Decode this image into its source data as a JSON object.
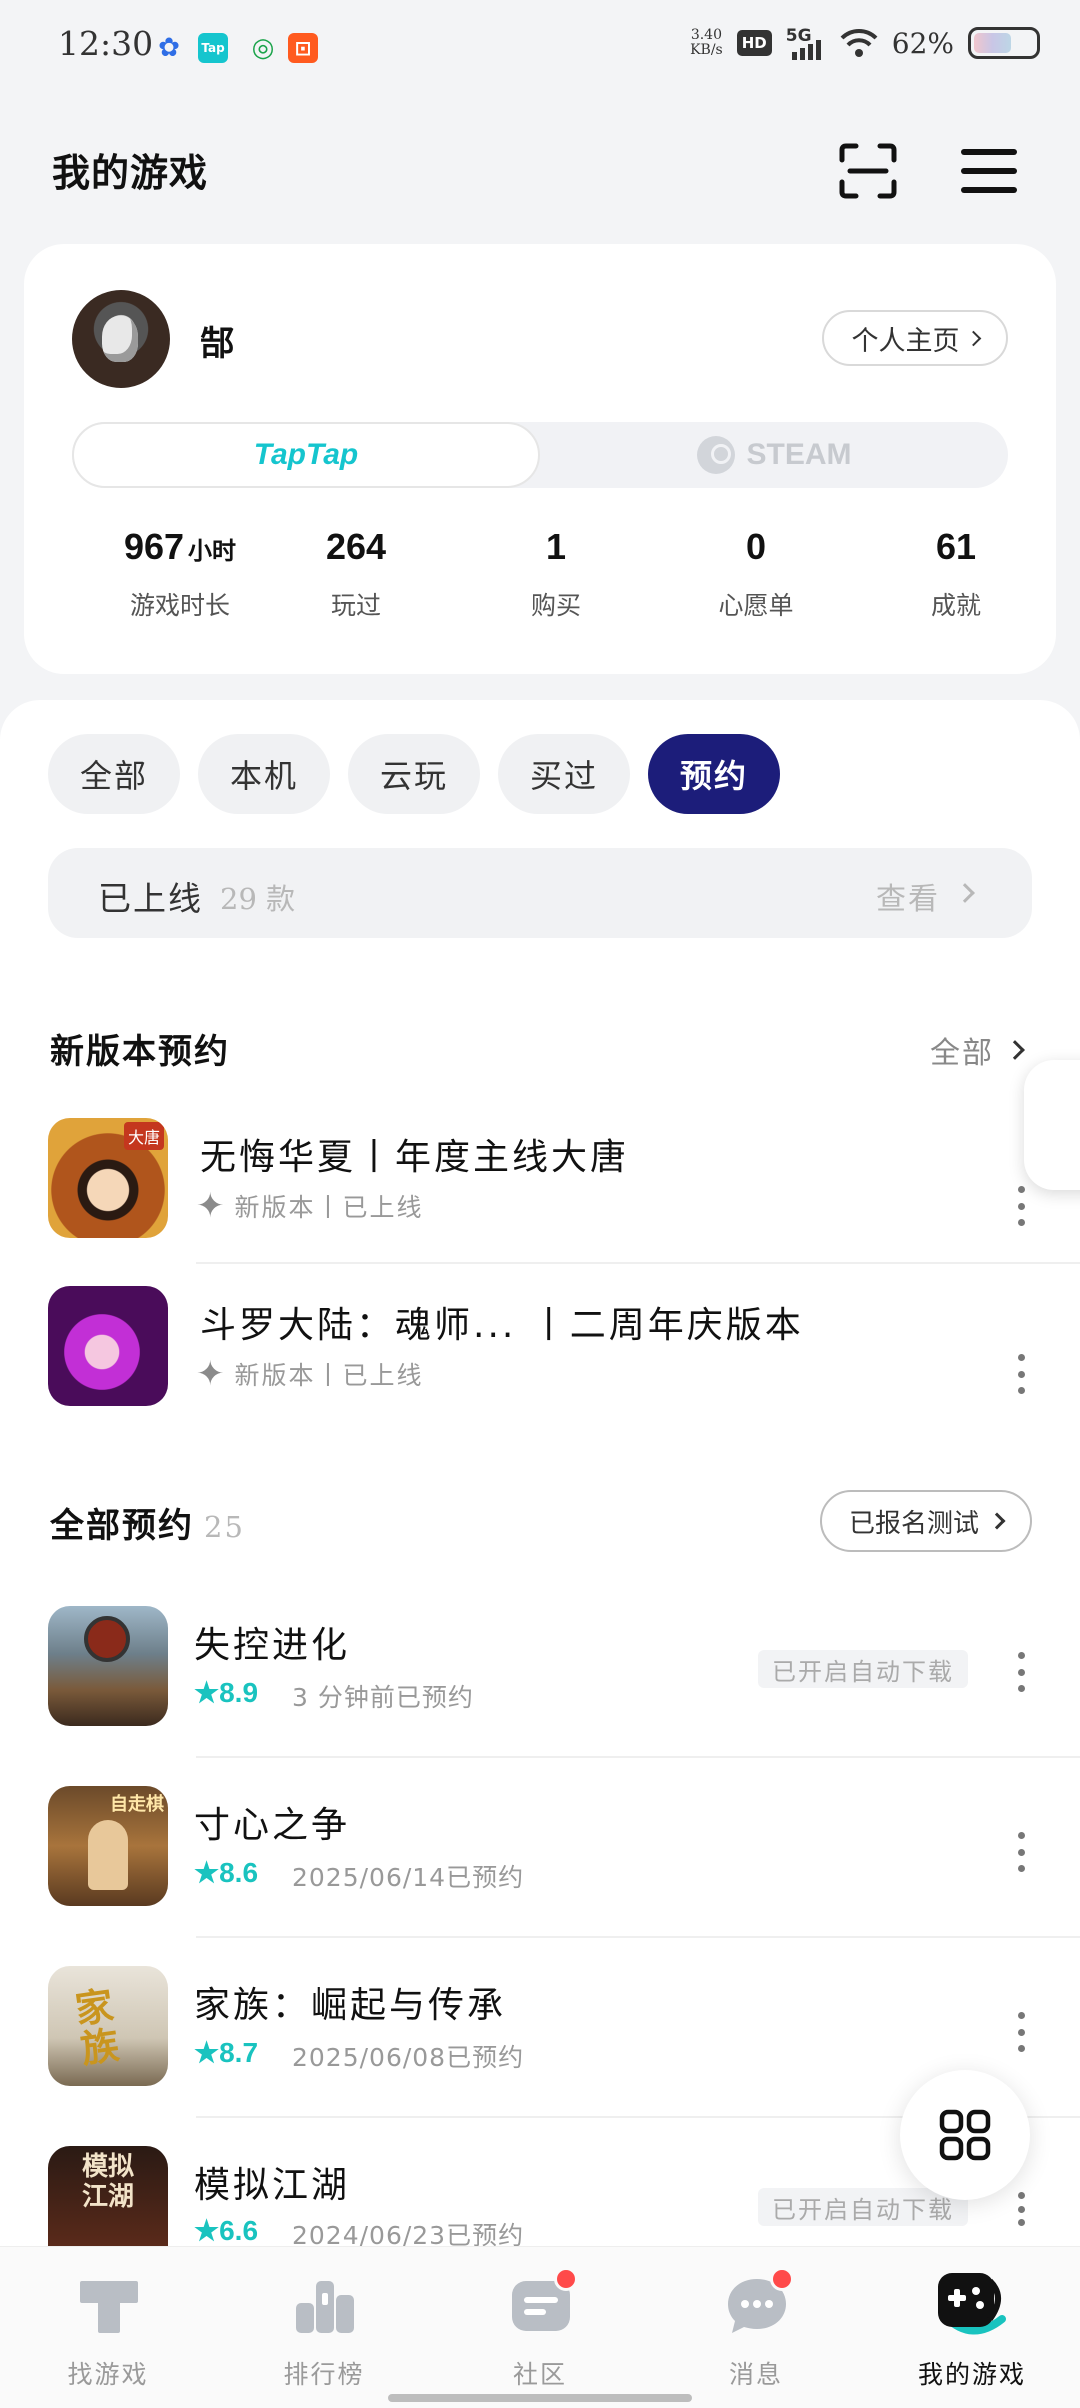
{
  "status_bar": {
    "time": "12:30",
    "app_icons": [
      "paw-icon",
      "taptap-icon",
      "china-mobile-icon",
      "taobao-icon"
    ],
    "taptap_icon_text": "Tap",
    "speed_value": "3.40",
    "speed_unit": "KB/s",
    "hd": "HD",
    "network": "5G",
    "battery": "62%"
  },
  "header": {
    "title": "我的游戏"
  },
  "profile": {
    "username": "郜",
    "homepage_button": "个人主页",
    "platforms": {
      "taptap": "TapTap",
      "steam": "STEAM"
    },
    "stats": [
      {
        "value": "967",
        "unit": "小时",
        "label": "游戏时长"
      },
      {
        "value": "264",
        "unit": "",
        "label": "玩过"
      },
      {
        "value": "1",
        "unit": "",
        "label": "购买"
      },
      {
        "value": "0",
        "unit": "",
        "label": "心愿单"
      },
      {
        "value": "61",
        "unit": "",
        "label": "成就"
      }
    ]
  },
  "filters": {
    "items": [
      "全部",
      "本机",
      "云玩",
      "买过",
      "预约"
    ],
    "active_index": 4
  },
  "online_bar": {
    "label": "已上线",
    "count": "29 款",
    "view": "查看"
  },
  "new_version_section": {
    "title": "新版本预约",
    "see_all": "全部",
    "items": [
      {
        "name": "无悔华夏丨年度主线大唐",
        "sub": "新版本丨已上线"
      },
      {
        "name": "斗罗大陆：魂师...  丨二周年庆版本",
        "sub": "新版本丨已上线"
      }
    ]
  },
  "reservations_section": {
    "title": "全部预约",
    "count": "25",
    "signup_button": "已报名测试",
    "items": [
      {
        "name": "失控进化",
        "rating": "★8.9",
        "time": "3 分钟前已预约",
        "auto_download": "已开启自动下载"
      },
      {
        "name": "寸心之争",
        "rating": "★8.6",
        "time": "2025/06/14已预约",
        "auto_download": ""
      },
      {
        "name": "家族：崛起与传承",
        "rating": "★8.7",
        "time": "2025/06/08已预约",
        "auto_download": ""
      },
      {
        "name": "模拟江湖",
        "rating": "★6.6",
        "time": "2024/06/23已预约",
        "auto_download": "已开启自动下载"
      }
    ]
  },
  "icon_texts": {
    "tang": "大唐",
    "zizou": "自走棋",
    "jiazu": "家族",
    "jianghu": "模拟江湖"
  },
  "bottom_nav": [
    {
      "label": "找游戏",
      "icon": "taptap-t-icon",
      "badge": false
    },
    {
      "label": "排行榜",
      "icon": "ranking-icon",
      "badge": false
    },
    {
      "label": "社区",
      "icon": "community-icon",
      "badge": true
    },
    {
      "label": "消息",
      "icon": "message-icon",
      "badge": true
    },
    {
      "label": "我的游戏",
      "icon": "gamepad-icon",
      "badge": false
    }
  ],
  "colors": {
    "accent_navy": "#1c1d7a",
    "taptap_teal": "#15c5ce",
    "rating_teal": "#19c3bf",
    "badge_red": "#ff4a4a"
  }
}
